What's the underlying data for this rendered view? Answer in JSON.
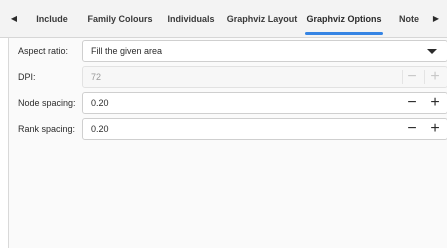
{
  "tabs": {
    "scroll_left_glyph": "◀",
    "scroll_right_glyph": "▶",
    "items": [
      {
        "label": "Include"
      },
      {
        "label": "Family Colours"
      },
      {
        "label": "Individuals"
      },
      {
        "label": "Graphviz Layout"
      },
      {
        "label": "Graphviz Options"
      },
      {
        "label": "Note"
      }
    ],
    "active_index": 4,
    "active_color": "#3584e4"
  },
  "options": {
    "aspect_ratio": {
      "label": "Aspect ratio:",
      "value": "Fill the given area"
    },
    "dpi": {
      "label": "DPI:",
      "value": "72",
      "minus": "−",
      "plus": "+"
    },
    "node_spacing": {
      "label": "Node spacing:",
      "value": "0.20",
      "minus": "−",
      "plus": "+"
    },
    "rank_spacing": {
      "label": "Rank spacing:",
      "value": "0.20",
      "minus": "−",
      "plus": "+"
    }
  }
}
